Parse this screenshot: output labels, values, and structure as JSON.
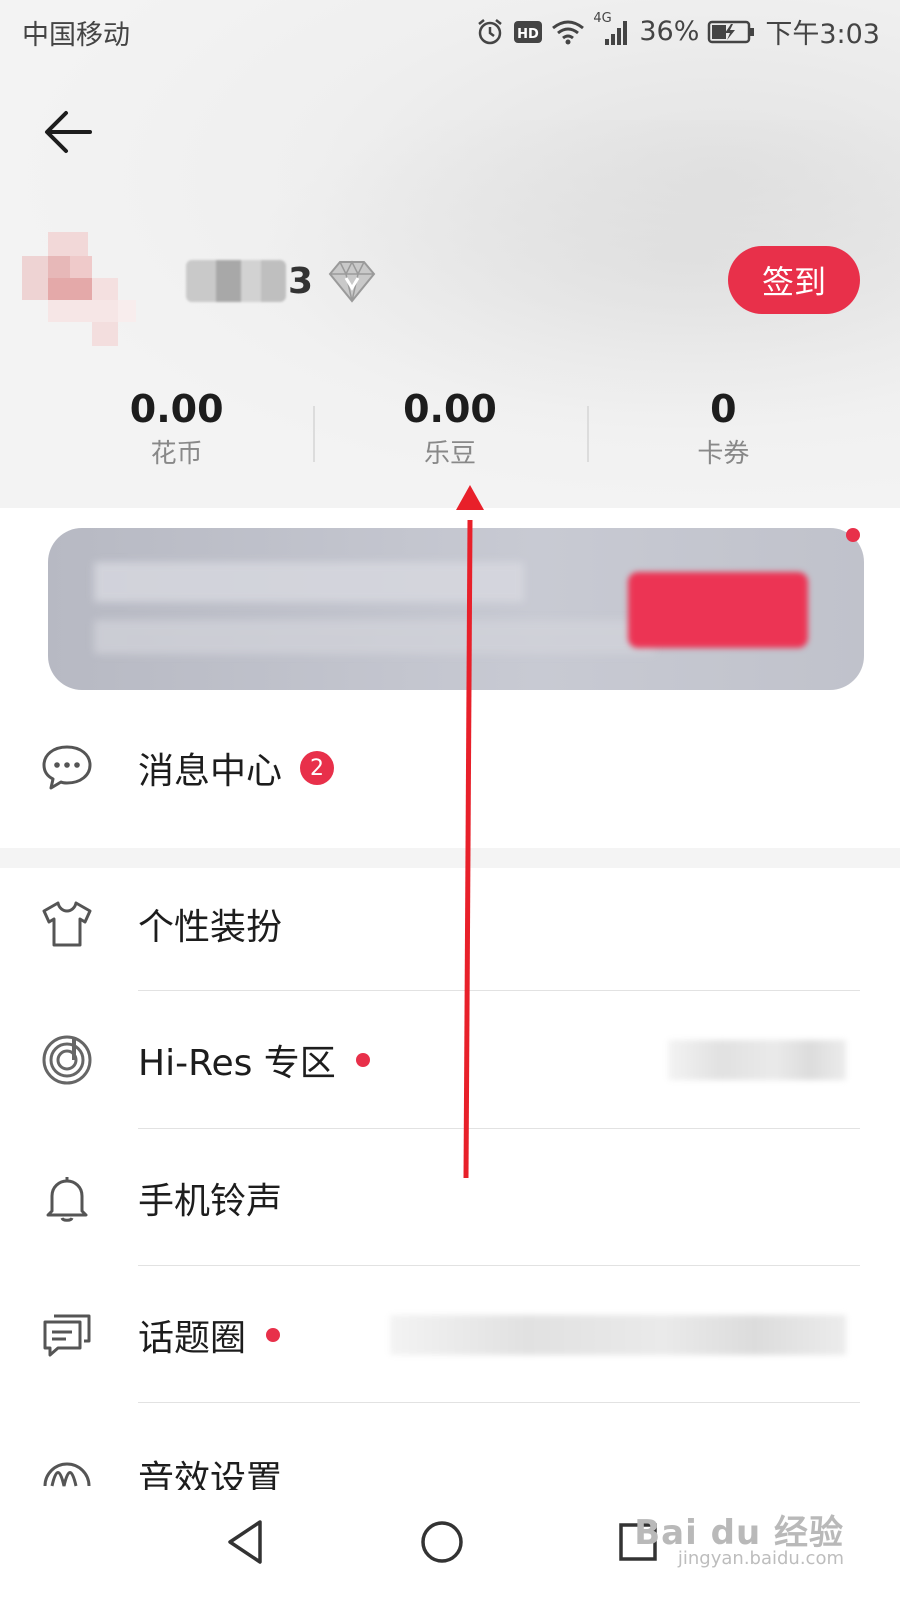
{
  "status_bar": {
    "carrier": "中国移动",
    "network": "4G",
    "battery": "36%",
    "time": "下午3:03"
  },
  "profile": {
    "name_visible_tail": "3",
    "sign_in_label": "签到"
  },
  "stats": [
    {
      "value": "0.00",
      "label": "花币"
    },
    {
      "value": "0.00",
      "label": "乐豆"
    },
    {
      "value": "0",
      "label": "卡券"
    }
  ],
  "menu": {
    "messages": {
      "label": "消息中心",
      "badge": "2"
    },
    "dressup": {
      "label": "个性装扮"
    },
    "hires": {
      "label": "Hi-Res 专区"
    },
    "ringtone": {
      "label": "手机铃声"
    },
    "topics": {
      "label": "话题圈"
    },
    "sound": {
      "label": "音效设置"
    }
  },
  "watermark": {
    "main": "Bai du 经验",
    "sub": "jingyan.baidu.com"
  },
  "colors": {
    "accent": "#e8304a",
    "arrow": "#e8202a"
  }
}
